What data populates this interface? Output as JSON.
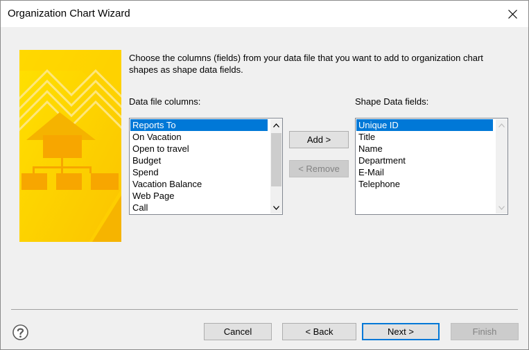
{
  "window": {
    "title": "Organization Chart Wizard"
  },
  "colors": {
    "accent": "#0078d7",
    "banner_yellow": "#fdd000",
    "banner_orange": "#f5b300"
  },
  "intro_text": "Choose the columns (fields) from your data file that you want to add to organization chart shapes as shape data fields.",
  "data_file": {
    "label": "Data file columns:",
    "items": [
      "Reports To",
      "On Vacation",
      "Open to travel",
      "Budget",
      "Spend",
      "Vacation Balance",
      "Web Page",
      "Call"
    ],
    "selected": "Reports To"
  },
  "shape_data": {
    "label": "Shape Data fields:",
    "items": [
      "Unique ID",
      "Title",
      "Name",
      "Department",
      "E-Mail",
      "Telephone"
    ],
    "selected": "Unique ID"
  },
  "buttons": {
    "add": "Add >",
    "remove": "< Remove",
    "cancel": "Cancel",
    "back": "< Back",
    "next": "Next >",
    "finish": "Finish"
  },
  "icons": {
    "close": "close-icon",
    "help": "help-icon",
    "scroll_up": "chevron-up-icon",
    "scroll_down": "chevron-down-icon"
  }
}
